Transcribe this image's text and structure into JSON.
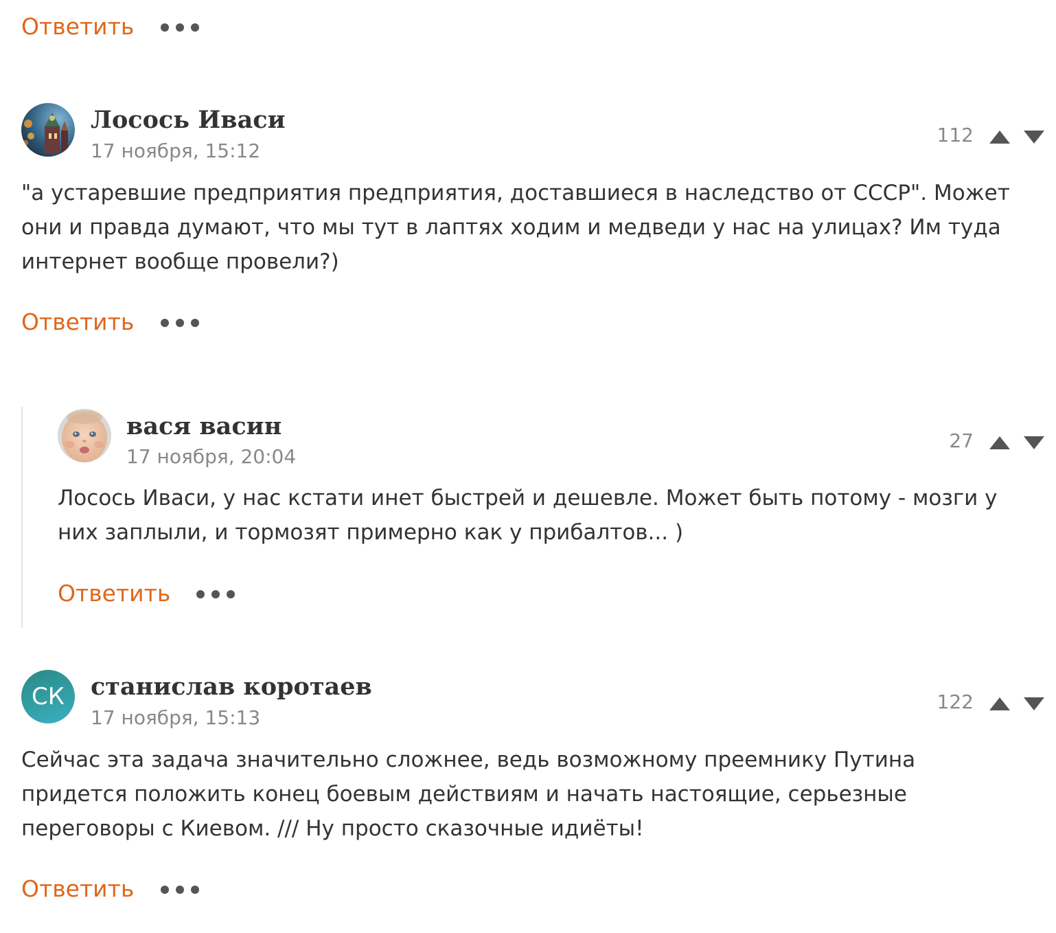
{
  "top_actions": {
    "reply_label": "Ответить"
  },
  "comments": [
    {
      "author": "Лосось Иваси",
      "date": "17 ноября, 15:12",
      "rating": "112",
      "text": "\"а устаревшие предприятия предприятия, доставшиеся в наследство от СССР\". Может они и правда думают, что мы тут в лаптях ходим и медведи у нас на улицах? Им туда интернет вообще провели?)",
      "reply_label": "Ответить"
    },
    {
      "author": "вася васин",
      "date": "17 ноября, 20:04",
      "rating": "27",
      "text": "Лосось Иваси, у нас кстати инет быстрей и дешевле. Может быть потому - мозги у них заплыли, и тормозят примерно как у прибалтов... )",
      "reply_label": "Ответить"
    },
    {
      "author": "станислав коротаев",
      "avatar_initials": "СК",
      "date": "17 ноября, 15:13",
      "rating": "122",
      "text": "Сейчас эта задача значительно сложнее, ведь возможному преемнику Путина придется положить конец боевым действиям и начать настоящие, серьезные переговоры с Киевом. /// Ну просто сказочные идиёты!",
      "reply_label": "Ответить"
    }
  ],
  "colors": {
    "accent": "#e0661a",
    "text": "#333333",
    "muted": "#888888",
    "icon": "#555555"
  },
  "icons": [
    "more-icon",
    "vote-up-icon",
    "vote-down-icon"
  ]
}
